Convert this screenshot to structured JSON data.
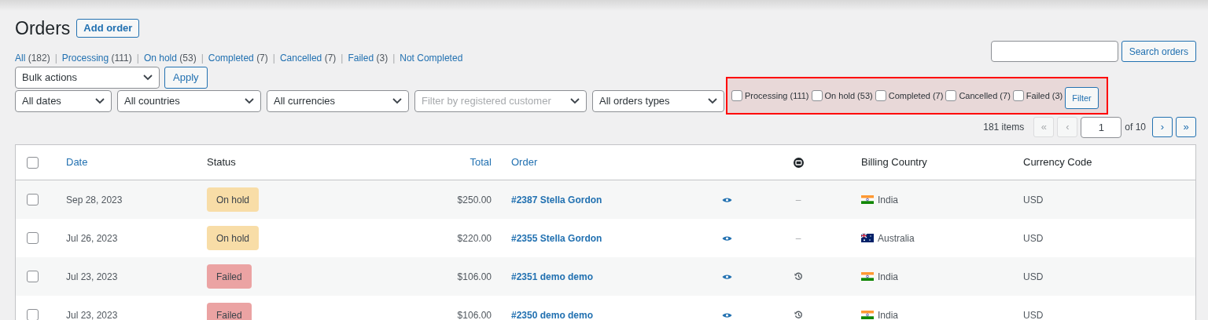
{
  "page": {
    "title": "Orders",
    "add_button": "Add order"
  },
  "status_links": {
    "separator": "|",
    "items": [
      {
        "label": "All",
        "count": "(182)"
      },
      {
        "label": "Processing",
        "count": "(111)"
      },
      {
        "label": "On hold",
        "count": "(53)"
      },
      {
        "label": "Completed",
        "count": "(7)"
      },
      {
        "label": "Cancelled",
        "count": "(7)"
      },
      {
        "label": "Failed",
        "count": "(3)"
      },
      {
        "label": "Not Completed"
      }
    ]
  },
  "search": {
    "button": "Search orders"
  },
  "bulk": {
    "select": "Bulk actions",
    "apply": "Apply"
  },
  "filters": [
    {
      "value": "All dates",
      "kind": "select"
    },
    {
      "value": "All countries",
      "kind": "select"
    },
    {
      "value": "All currencies",
      "kind": "select"
    },
    {
      "placeholder": "Filter by registered customer",
      "kind": "placeholder"
    },
    {
      "value": "All orders types",
      "kind": "select"
    }
  ],
  "status_filter": {
    "options": [
      {
        "label": "Processing (111)",
        "checked": false
      },
      {
        "label": "On hold (53)",
        "checked": false
      },
      {
        "label": "Completed (7)",
        "checked": false
      },
      {
        "label": "Cancelled (7)",
        "checked": false
      },
      {
        "label": "Failed (3)",
        "checked": false
      }
    ],
    "button": "Filter"
  },
  "pagination": {
    "items": "181 items",
    "buttons_before": [
      {
        "label": "«",
        "disabled": true
      },
      {
        "label": "‹",
        "disabled": true
      }
    ],
    "page": "1",
    "of": "of 10",
    "buttons_after": [
      {
        "label": "›",
        "disabled": false
      },
      {
        "label": "»",
        "disabled": false
      }
    ]
  },
  "table": {
    "select_all_checked": false,
    "columns": [
      "Date",
      "Status",
      "Total",
      "Order",
      "Billing Country",
      "Currency Code"
    ],
    "rows": [
      {
        "checked": false,
        "date": "Sep 28, 2023",
        "status": {
          "label": "On hold",
          "color": "#f8dda7"
        },
        "total": "$250.00",
        "order": "#2387 Stella Gordon",
        "note": {
          "kind": "dash",
          "text": "–"
        },
        "country": {
          "kind": "in",
          "name": "India"
        },
        "currency": "USD"
      },
      {
        "checked": false,
        "date": "Jul 26, 2023",
        "status": {
          "label": "On hold",
          "color": "#f8dda7"
        },
        "total": "$220.00",
        "order": "#2355 Stella Gordon",
        "note": {
          "kind": "dash",
          "text": "–"
        },
        "country": {
          "kind": "au",
          "name": "Australia"
        },
        "currency": "USD"
      },
      {
        "checked": false,
        "date": "Jul 23, 2023",
        "status": {
          "label": "Failed",
          "color": "#eba3a3"
        },
        "total": "$106.00",
        "order": "#2351 demo demo",
        "note": {
          "kind": "history"
        },
        "country": {
          "kind": "in",
          "name": "India"
        },
        "currency": "USD"
      },
      {
        "checked": false,
        "date": "Jul 23, 2023",
        "status": {
          "label": "Failed",
          "color": "#eba3a3"
        },
        "total": "$106.00",
        "order": "#2350 demo demo",
        "note": {
          "kind": "history"
        },
        "country": {
          "kind": "in",
          "name": "India"
        },
        "currency": "USD"
      }
    ]
  }
}
